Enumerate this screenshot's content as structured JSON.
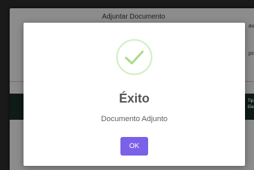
{
  "background_window": {
    "title": "Adjuntar Documento",
    "fragment_right_top": "ava",
    "fragment_right_mid": "pre",
    "fragment_bar_line1": "Tip",
    "fragment_bar_line2": "Ele"
  },
  "dialog": {
    "icon": "success-check-icon",
    "title": "Éxito",
    "message": "Documento Adjunto",
    "ok_label": "OK"
  },
  "colors": {
    "accent": "#7b61e8",
    "success": "#a5dc86",
    "overlay": "#1a1a1a"
  }
}
